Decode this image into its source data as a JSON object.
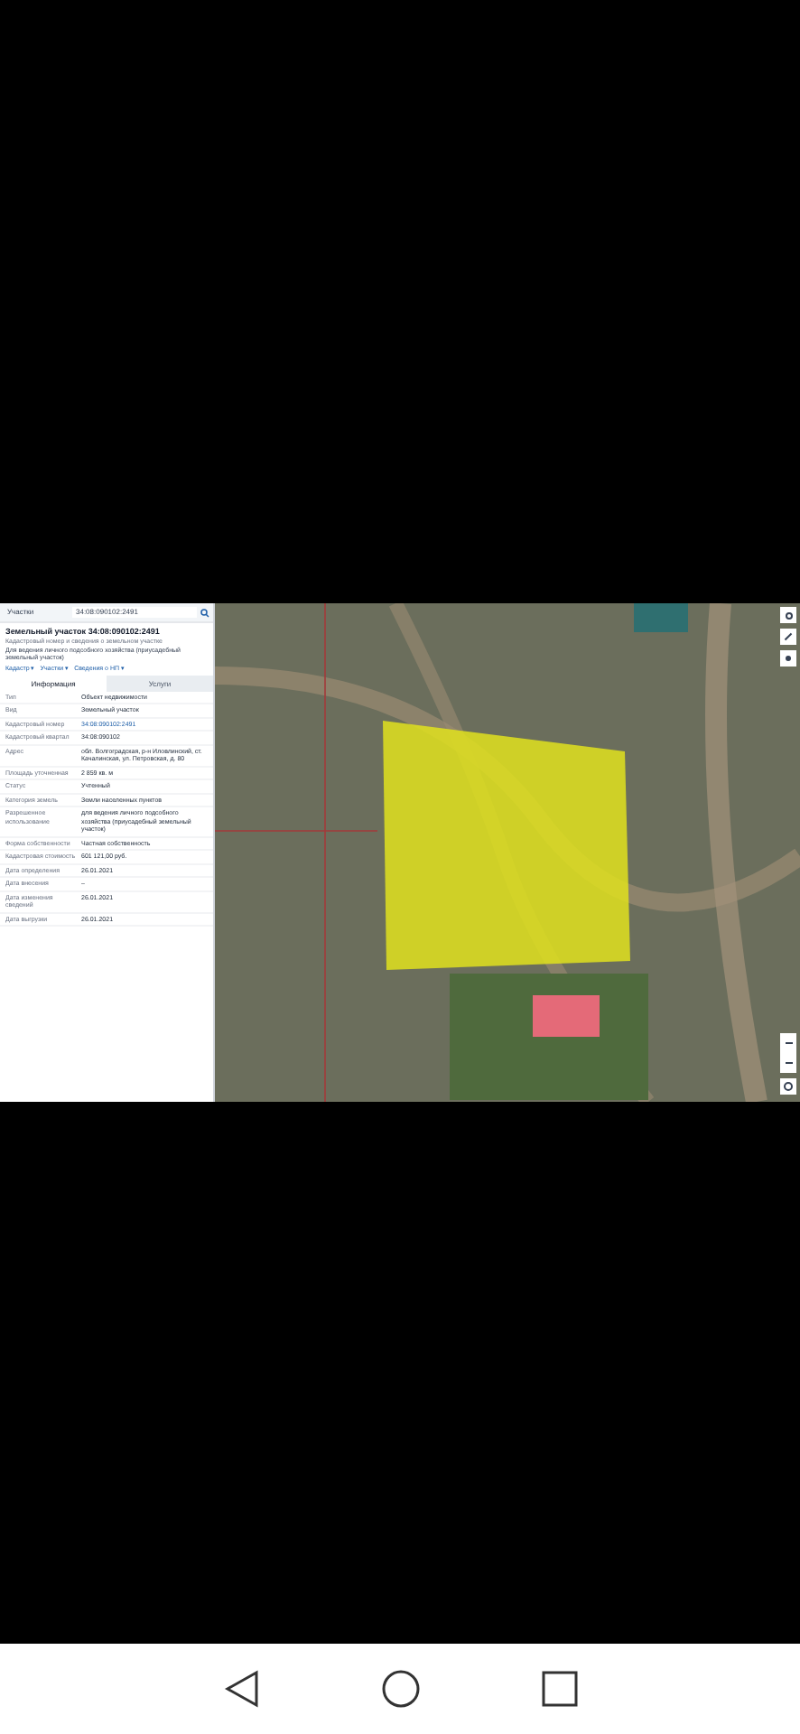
{
  "search": {
    "layer": "Участки",
    "value": "34:08:090102:2491"
  },
  "parcel": {
    "title": "Земельный участок 34:08:090102:2491",
    "subtitle": "Кадастровый номер и сведения о земельном участке",
    "purpose": "Для ведения личного подсобного хозяйства (приусадебный земельный участок)"
  },
  "toolbar": [
    {
      "label": "Кадастр ▾"
    },
    {
      "label": "Участки ▾"
    },
    {
      "label": "Сведения о НП ▾"
    }
  ],
  "tabs": [
    {
      "label": "Информация",
      "selected": true
    },
    {
      "label": "Услуги",
      "selected": false
    }
  ],
  "rows": [
    {
      "label": "Тип",
      "value": "Объект недвижимости",
      "kind": "text"
    },
    {
      "label": "Вид",
      "value": "Земельный участок",
      "kind": "text"
    },
    {
      "label": "Кадастровый номер",
      "value": "34:08:090102:2491",
      "kind": "link"
    },
    {
      "label": "Кадастровый квартал",
      "value": "34:08:090102",
      "kind": "text"
    },
    {
      "label": "Адрес",
      "value": "обл. Волгоградская, р-н Иловлинский, ст. Качалинская, ул. Петровская, д. 80",
      "kind": "text"
    },
    {
      "label": "Площадь уточненная",
      "value": "2 859 кв. м",
      "kind": "text"
    },
    {
      "label": "Статус",
      "value": "Учтенный",
      "kind": "text"
    },
    {
      "label": "Категория земель",
      "value": "Земли населенных пунктов",
      "kind": "text"
    },
    {
      "label": "Разрешенное использование",
      "value": "для ведения личного подсобного хозяйства (приусадебный земельный участок)",
      "kind": "text"
    },
    {
      "label": "Форма собственности",
      "value": "Частная собственность",
      "kind": "text"
    },
    {
      "label": "Кадастровая стоимость",
      "value": "601 121,00 руб.",
      "kind": "text"
    },
    {
      "label": "Дата определения",
      "value": "26.01.2021",
      "kind": "text"
    },
    {
      "label": "Дата внесения",
      "value": "–",
      "kind": "text"
    },
    {
      "label": "Дата изменения сведений",
      "value": "26.01.2021",
      "kind": "text"
    },
    {
      "label": "Дата выгрузки",
      "value": "26.01.2021",
      "kind": "text"
    }
  ]
}
